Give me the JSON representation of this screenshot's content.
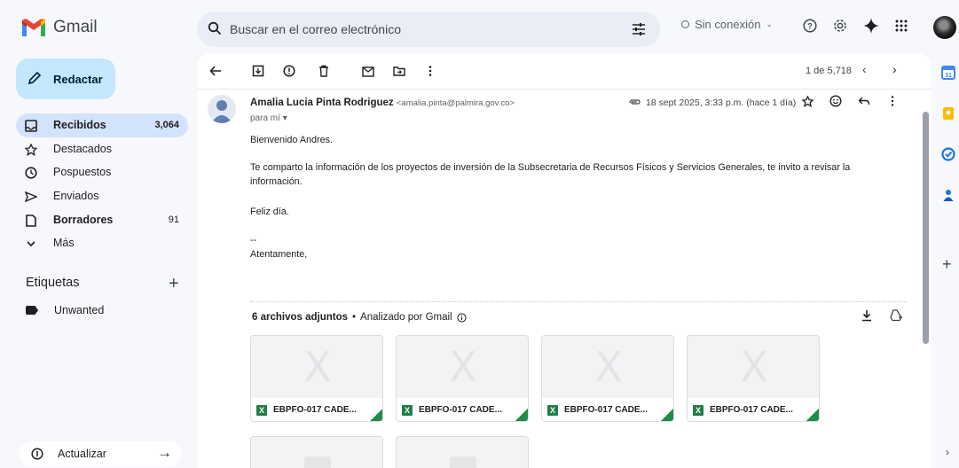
{
  "app": {
    "name": "Gmail"
  },
  "search": {
    "placeholder": "Buscar en el correo electrónico"
  },
  "status": {
    "offline_label": "Sin conexión"
  },
  "compose": {
    "label": "Redactar"
  },
  "sidebar": {
    "items": [
      {
        "label": "Recibidos",
        "count": "3,064",
        "bold": true,
        "active": true,
        "icon": "inbox-icon"
      },
      {
        "label": "Destacados",
        "count": "",
        "bold": false,
        "icon": "star-icon"
      },
      {
        "label": "Pospuestos",
        "count": "",
        "bold": false,
        "icon": "clock-icon"
      },
      {
        "label": "Enviados",
        "count": "",
        "bold": false,
        "icon": "send-icon"
      },
      {
        "label": "Borradores",
        "count": "91",
        "bold": true,
        "icon": "draft-icon"
      },
      {
        "label": "Más",
        "count": "",
        "bold": false,
        "icon": "chevron-down-icon"
      }
    ],
    "labels_heading": "Etiquetas",
    "labels": [
      {
        "name": "Unwanted"
      }
    ],
    "refresh_label": "Actualizar"
  },
  "toolbar": {
    "pager": "1 de 5,718"
  },
  "email": {
    "sender_name": "Amalia Lucia Pinta Rodriguez",
    "sender_email": "<amalia.pinta@palmira.gov.co>",
    "to": "para mí",
    "date": "18 sept 2025, 3:33 p.m. (hace 1 día)",
    "body": [
      "Bienvenido Andres.",
      "Te comparto la información de los proyectos de inversión de la Subsecretaria de Recursos Físicos y Servicios Generales, te invito a revisar la información.",
      "Feliz día.",
      "--",
      "Atentamente,"
    ]
  },
  "attachments": {
    "count_label": "6 archivos adjuntos",
    "scanned_label": "Analizado por Gmail",
    "files": [
      {
        "name": "EBPFO-017 CADE...",
        "type_badge": "X"
      },
      {
        "name": "EBPFO-017 CADE...",
        "type_badge": "X"
      },
      {
        "name": "EBPFO-017 CADE...",
        "type_badge": "X"
      },
      {
        "name": "EBPFO-017 CADE...",
        "type_badge": "X"
      }
    ]
  },
  "colors": {
    "compose_bg": "#c2e7ff",
    "active_nav": "#d3e3fd",
    "excel_green": "#1e7e45"
  }
}
